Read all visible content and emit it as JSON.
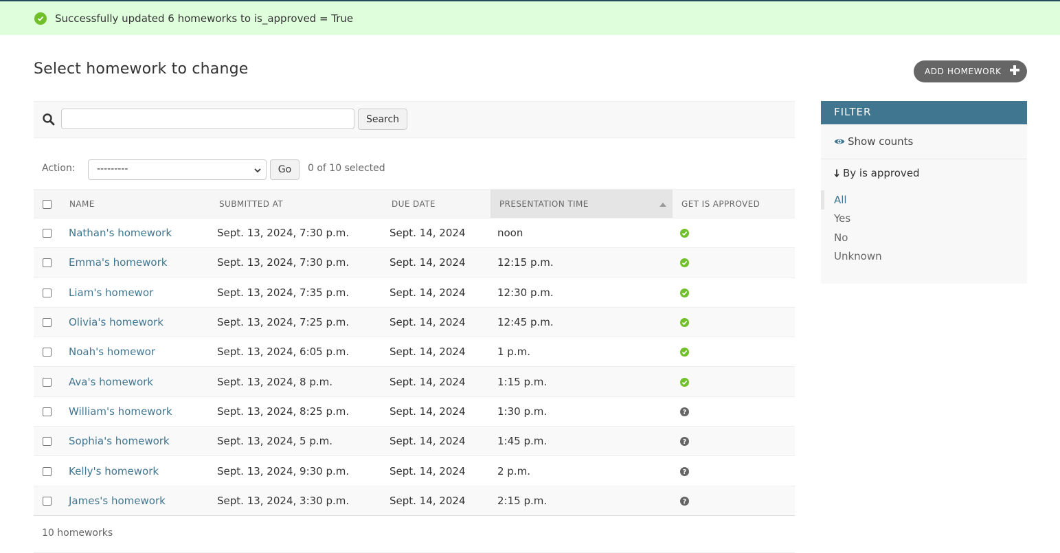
{
  "message": {
    "text": "Successfully updated 6 homeworks to is_approved = True",
    "icon": "success-check-icon"
  },
  "page": {
    "title": "Select homework to change",
    "add_button": "ADD HOMEWORK"
  },
  "search": {
    "value": "",
    "placeholder": "",
    "button": "Search"
  },
  "actions": {
    "label": "Action:",
    "selected_option": "---------",
    "go_button": "Go",
    "selected_count": "0 of 10 selected"
  },
  "table": {
    "headers": {
      "name": "NAME",
      "submitted_at": "SUBMITTED AT",
      "due_date": "DUE DATE",
      "presentation_time": "PRESENTATION TIME",
      "get_is_approved": "GET IS APPROVED"
    },
    "sorted_column": "presentation_time",
    "sort_direction": "ascending",
    "rows": [
      {
        "name": "Nathan's homework",
        "submitted_at": "Sept. 13, 2024, 7:30 p.m.",
        "due_date": "Sept. 14, 2024",
        "presentation_time": "noon",
        "approved": "yes"
      },
      {
        "name": "Emma's homework",
        "submitted_at": "Sept. 13, 2024, 7:30 p.m.",
        "due_date": "Sept. 14, 2024",
        "presentation_time": "12:15 p.m.",
        "approved": "yes"
      },
      {
        "name": "Liam's homewor",
        "submitted_at": "Sept. 13, 2024, 7:35 p.m.",
        "due_date": "Sept. 14, 2024",
        "presentation_time": "12:30 p.m.",
        "approved": "yes"
      },
      {
        "name": "Olivia's homework",
        "submitted_at": "Sept. 13, 2024, 7:25 p.m.",
        "due_date": "Sept. 14, 2024",
        "presentation_time": "12:45 p.m.",
        "approved": "yes"
      },
      {
        "name": "Noah's homewor",
        "submitted_at": "Sept. 13, 2024, 6:05 p.m.",
        "due_date": "Sept. 14, 2024",
        "presentation_time": "1 p.m.",
        "approved": "yes"
      },
      {
        "name": "Ava's homework",
        "submitted_at": "Sept. 13, 2024, 8 p.m.",
        "due_date": "Sept. 14, 2024",
        "presentation_time": "1:15 p.m.",
        "approved": "yes"
      },
      {
        "name": "William's homework",
        "submitted_at": "Sept. 13, 2024, 8:25 p.m.",
        "due_date": "Sept. 14, 2024",
        "presentation_time": "1:30 p.m.",
        "approved": "unknown"
      },
      {
        "name": "Sophia's homework",
        "submitted_at": "Sept. 13, 2024, 5 p.m.",
        "due_date": "Sept. 14, 2024",
        "presentation_time": "1:45 p.m.",
        "approved": "unknown"
      },
      {
        "name": "Kelly's homework",
        "submitted_at": "Sept. 13, 2024, 9:30 p.m.",
        "due_date": "Sept. 14, 2024",
        "presentation_time": "2 p.m.",
        "approved": "unknown"
      },
      {
        "name": "James's homework",
        "submitted_at": "Sept. 13, 2024, 3:30 p.m.",
        "due_date": "Sept. 14, 2024",
        "presentation_time": "2:15 p.m.",
        "approved": "unknown"
      }
    ]
  },
  "paginator": {
    "text": "10 homeworks"
  },
  "filter": {
    "header": "FILTER",
    "show_counts": "Show counts",
    "title": "By is approved",
    "options": [
      "All",
      "Yes",
      "No",
      "Unknown"
    ],
    "selected": "All"
  },
  "colors": {
    "link": "#417690",
    "filter_header": "#417690",
    "success_bg": "#dfffdc",
    "approved_icon": "#70bf2b",
    "unknown_icon": "#666666",
    "add_button_bg": "#666666"
  }
}
